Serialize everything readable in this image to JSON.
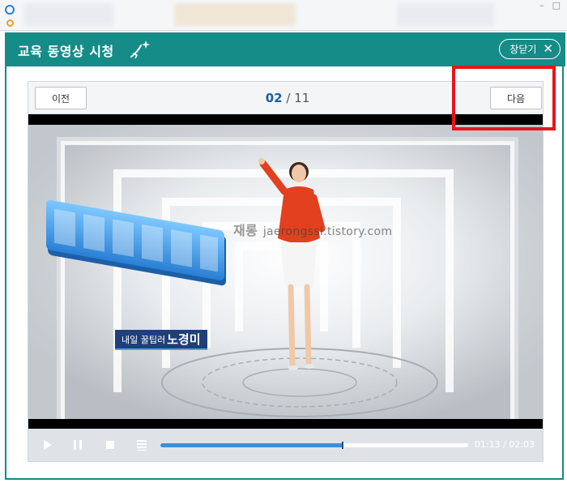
{
  "popup": {
    "title": "교육 동영상 시청",
    "close_label": "창닫기",
    "close_icon": "x-icon"
  },
  "navigation": {
    "prev_label": "이전",
    "next_label": "다음",
    "current_page": "02",
    "separator": "/",
    "total_pages": "11"
  },
  "video": {
    "caption_sub": "내일 꿀팁러",
    "caption_name": "노경미",
    "watermark_prefix": "재롱",
    "watermark_text": "jaerongssi.tistory.com"
  },
  "player_controls": {
    "play_icon": "play-icon",
    "pause_icon": "pause-icon",
    "stop_icon": "stop-icon",
    "menu_icon": "menu-icon",
    "progress": 0.59,
    "elapsed": "01:13",
    "time_separator": "/",
    "duration": "02:03"
  },
  "colors": {
    "header": "#158c87",
    "accent": "#1a5fa6",
    "progress": "#3d8ed8",
    "highlight": "#e8141c"
  }
}
